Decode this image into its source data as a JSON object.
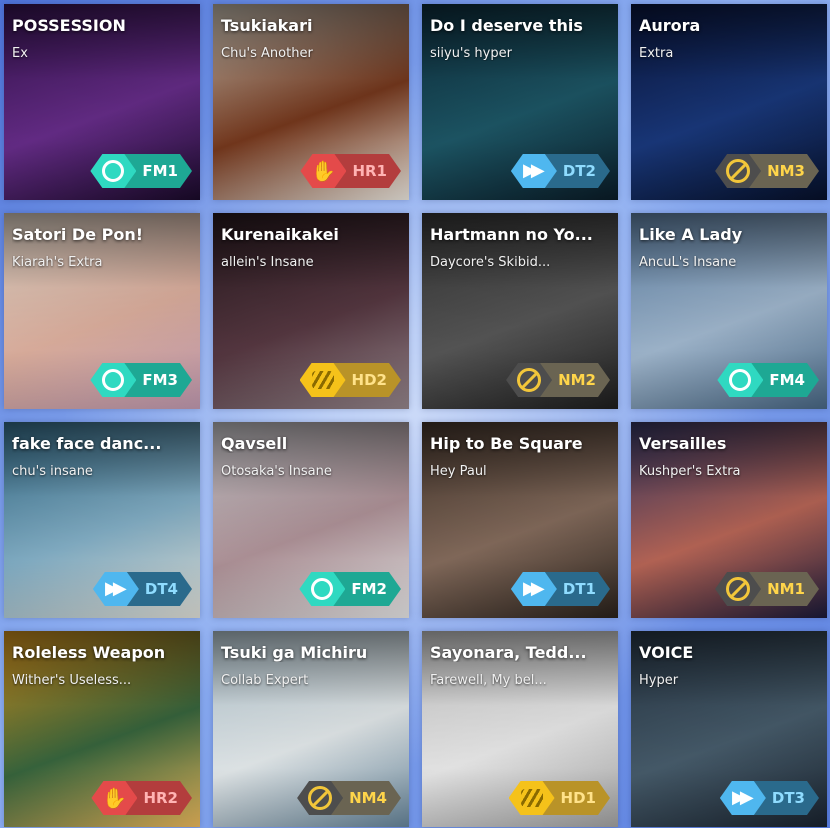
{
  "cards": [
    {
      "title": "POSSESSION",
      "difficulty": "Ex",
      "mod": {
        "type": "fm",
        "code": "FM1",
        "icon": "ring-icon"
      },
      "colors": [
        "#3a1456",
        "#6a2e8e",
        "#1a0a2a"
      ]
    },
    {
      "title": "Tsukiakari",
      "difficulty": "Chu's Another",
      "mod": {
        "type": "hr",
        "code": "HR1",
        "icon": "rock-hand-icon"
      },
      "colors": [
        "#d8cfc0",
        "#7a3a1e",
        "#f4efe6"
      ]
    },
    {
      "title": "Do I deserve this",
      "difficulty": "siiyu's hyper",
      "mod": {
        "type": "dt",
        "code": "DT2",
        "icon": "fast-forward-icon"
      },
      "colors": [
        "#0e3040",
        "#1e5a6a",
        "#0a1c28"
      ]
    },
    {
      "title": "Aurora",
      "difficulty": "Extra",
      "mod": {
        "type": "nm",
        "code": "NM3",
        "icon": "no-mod-icon"
      },
      "colors": [
        "#0a1640",
        "#1a3a80",
        "#06102a"
      ]
    },
    {
      "title": "Satori De Pon!",
      "difficulty": "Kiarah's Extra",
      "mod": {
        "type": "fm",
        "code": "FM3",
        "icon": "ring-icon"
      },
      "colors": [
        "#f4e7d8",
        "#e8b8a6",
        "#c9a0b8"
      ]
    },
    {
      "title": "Kurenaikakei",
      "difficulty": "allein's Insane",
      "mod": {
        "type": "hd",
        "code": "HD2",
        "icon": "hidden-icon"
      },
      "colors": [
        "#2a1a20",
        "#5a3a44",
        "#9a8a90"
      ]
    },
    {
      "title": "Hartmann no Yo...",
      "difficulty": "Daycore's Skibid...",
      "mod": {
        "type": "nm",
        "code": "NM2",
        "icon": "no-mod-icon"
      },
      "colors": [
        "#3a3a3a",
        "#5a5a5a",
        "#1e1e1e"
      ]
    },
    {
      "title": "Like A Lady",
      "difficulty": "AncuL's Insane",
      "mod": {
        "type": "fm",
        "code": "FM4",
        "icon": "ring-icon"
      },
      "colors": [
        "#6a90b8",
        "#a8c0d8",
        "#4a6a88"
      ]
    },
    {
      "title": "fake face danc...",
      "difficulty": "chu's insane",
      "mod": {
        "type": "dt",
        "code": "DT4",
        "icon": "fast-forward-icon"
      },
      "colors": [
        "#3a7898",
        "#8ab8d0",
        "#e8e8e0"
      ]
    },
    {
      "title": "Qavsell",
      "difficulty": "Otosaka's Insane",
      "mod": {
        "type": "fm",
        "code": "FM2",
        "icon": "ring-icon"
      },
      "colors": [
        "#d8d8dc",
        "#b89aa0",
        "#eeeeee"
      ]
    },
    {
      "title": "Hip to Be Square",
      "difficulty": "Hey Paul",
      "mod": {
        "type": "dt",
        "code": "DT1",
        "icon": "fast-forward-icon"
      },
      "colors": [
        "#4a3a30",
        "#8a7060",
        "#2a221c"
      ]
    },
    {
      "title": "Versailles",
      "difficulty": "Kushper's Extra",
      "mod": {
        "type": "nm",
        "code": "NM1",
        "icon": "no-mod-icon"
      },
      "colors": [
        "#3a3a6a",
        "#c06a5a",
        "#1a1a3a"
      ]
    },
    {
      "title": "Roleless Weapon",
      "difficulty": "Wither's Useless...",
      "mod": {
        "type": "hr",
        "code": "HR2",
        "icon": "rock-hand-icon"
      },
      "colors": [
        "#e8a020",
        "#3a6a40",
        "#f4c060"
      ]
    },
    {
      "title": "Tsuki ga Michiru",
      "difficulty": "Collab Expert",
      "mod": {
        "type": "nm",
        "code": "NM4",
        "icon": "no-mod-icon"
      },
      "colors": [
        "#c8dde8",
        "#eef4f6",
        "#6a8aa0"
      ]
    },
    {
      "title": "Sayonara, Tedd...",
      "difficulty": "Farewell, My bel...",
      "mod": {
        "type": "hd",
        "code": "HD1",
        "icon": "hidden-icon"
      },
      "colors": [
        "#dcdcdc",
        "#f4f4f4",
        "#a8a8a8"
      ]
    },
    {
      "title": "VOICE",
      "difficulty": "Hyper",
      "mod": {
        "type": "dt",
        "code": "DT3",
        "icon": "fast-forward-icon"
      },
      "colors": [
        "#2a3a4a",
        "#4a6070",
        "#1a2430"
      ]
    }
  ]
}
